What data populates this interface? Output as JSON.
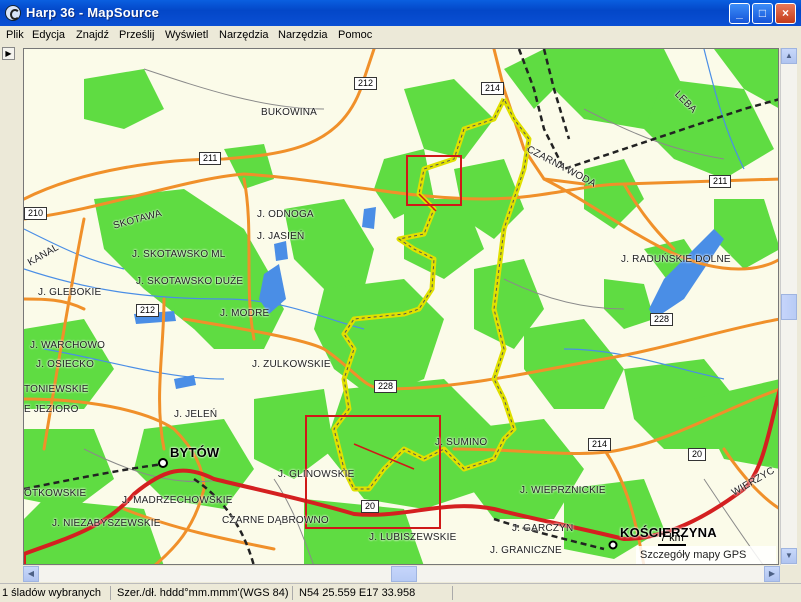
{
  "window": {
    "title": "Harp 36 - MapSource",
    "minimize": "_",
    "maximize": "□",
    "close": "×"
  },
  "menu": [
    "Plik",
    "Edycja",
    "Znajdź",
    "Prześlij",
    "Wyświetl",
    "Narzędzia",
    "Narzędzia",
    "Pomoc"
  ],
  "toolbar": {
    "arrow": "▶"
  },
  "map": {
    "places": [
      {
        "name": "BUKOWINA"
      },
      {
        "name": "CZARNA WODA"
      },
      {
        "name": "LEBA"
      },
      {
        "name": "SKOTAWA"
      },
      {
        "name": "J. ODNOGA"
      },
      {
        "name": "J. JASIEŃ"
      },
      {
        "name": "KANAL"
      },
      {
        "name": "J. SKOTAWSKO ML"
      },
      {
        "name": "J. SKOTAWSKO DUŻE"
      },
      {
        "name": "J. GLEBOKIE"
      },
      {
        "name": "J. MODRE"
      },
      {
        "name": "J. WARCHOWO"
      },
      {
        "name": "J. OSIECKO"
      },
      {
        "name": "TONIEWSKIE"
      },
      {
        "name": "E JEZIORO"
      },
      {
        "name": "J. ZULKOWSKIE"
      },
      {
        "name": "J. JELEŃ"
      },
      {
        "name": "J. RADUŃSKIE DOLNE"
      },
      {
        "name": "J. SUMINO"
      },
      {
        "name": "J. GLINOWSKIE"
      },
      {
        "name": "J. WIEPRZNICKIE"
      },
      {
        "name": "OTKOWSKIE"
      },
      {
        "name": "J. MADRZECHOWSKIE"
      },
      {
        "name": "J. NIEZABYSZEWSKIE"
      },
      {
        "name": "CZARNE DĄBROWNO"
      },
      {
        "name": "J. LUBISZEWSKIE"
      },
      {
        "name": "J. GARCZYN"
      },
      {
        "name": "J. GRANICZNE"
      },
      {
        "name": "WIERZYC"
      }
    ],
    "towns": [
      {
        "name": "BYTÓW"
      },
      {
        "name": "KOŚCIERZYNA"
      }
    ],
    "roads": [
      "212",
      "214",
      "211",
      "210",
      "212",
      "211",
      "228",
      "228",
      "214",
      "20",
      "20"
    ],
    "scale": "7 km",
    "detail": "Szczegóły mapy GPS"
  },
  "status": {
    "selected": "1 śladów wybranych",
    "format": "Szer./dł. hddd°mm.mmm'(WGS 84)",
    "coords": "N54 25.559 E17 33.958"
  },
  "colors": {
    "forest": "#5fdc42",
    "road": "#f0902a",
    "main_road": "#d42020",
    "track": "#f2f000",
    "water": "#4a8ee6",
    "bg": "#fbfbe9",
    "highlight": "#d01818"
  }
}
